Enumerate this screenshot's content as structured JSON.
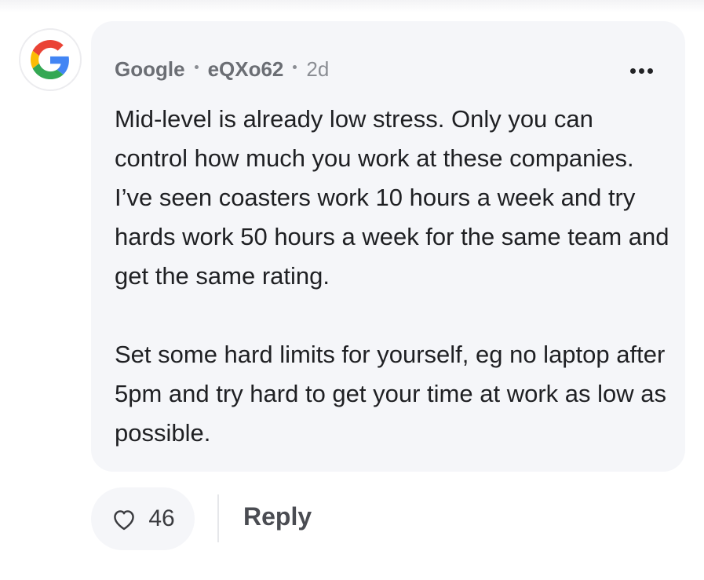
{
  "comment": {
    "author": {
      "company": "Google",
      "username": "eQXo62",
      "time_ago": "2d",
      "avatar_icon": "google-logo-icon"
    },
    "body": {
      "paragraph_1": "Mid-level is already low stress. Only you can control how much you work at these companies. I’ve seen coasters work 10 hours a week and try hards work 50 hours a week for the same team and get the same rating.",
      "paragraph_2": "Set some hard limits for yourself, eg no laptop after 5pm and try hard to get your time at work as low as possible."
    },
    "more_icon": "more-options-icon"
  },
  "actions": {
    "like_icon": "heart-icon",
    "like_count": "46",
    "reply_label": "Reply"
  },
  "colors": {
    "bubble_background": "#f5f6f9",
    "text_primary": "#1f2023",
    "text_secondary": "#6b6e74",
    "google_blue": "#4285F4",
    "google_red": "#EA4335",
    "google_yellow": "#FBBC05",
    "google_green": "#34A853"
  }
}
